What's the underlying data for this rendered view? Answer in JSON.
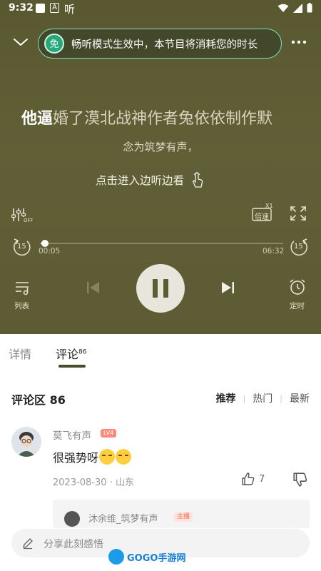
{
  "status_bar": {
    "time": "9:32",
    "a_label": "A",
    "ting_label": "听"
  },
  "banner": {
    "badge": "免",
    "text": "畅听模式生效中，本节目将消耗您的时长"
  },
  "lyrics": {
    "current_highlight": "他逼",
    "current_rest": "婚了漠北战神作者兔依依制作默",
    "next": "念为筑梦有声，",
    "enter_prompt": "点击进入边听边看"
  },
  "controls": {
    "speed_label": "倍速",
    "speed_badge": "X1",
    "off_label": "OFF",
    "skip_seconds": "15",
    "current_time": "00:05",
    "total_time": "06:32",
    "progress_fraction": 0.013,
    "list_label": "列表",
    "timer_label": "定时"
  },
  "tabs": [
    {
      "label": "详情",
      "active": false
    },
    {
      "label": "评论",
      "count": "86",
      "active": true
    }
  ],
  "comments_header": {
    "title": "评论区 86",
    "sort_options": [
      "推荐",
      "热门",
      "最新"
    ],
    "active_sort": "推荐"
  },
  "comment": {
    "user": "莫飞有声",
    "level": "LV4",
    "text": "很强势呀",
    "date": "2023-08-30",
    "location": "山东",
    "likes": "7"
  },
  "reply": {
    "user": "沐余维_筑梦有声",
    "tag": "主播"
  },
  "input": {
    "placeholder": "分享此刻感悟"
  },
  "watermark": {
    "text": "GOGO手游网"
  },
  "colors": {
    "player_bg": "#5d5b34",
    "banner_border": "#7be0c0",
    "banner_badge": "#28a87a",
    "tab_indicator": "#4b4a2c"
  }
}
